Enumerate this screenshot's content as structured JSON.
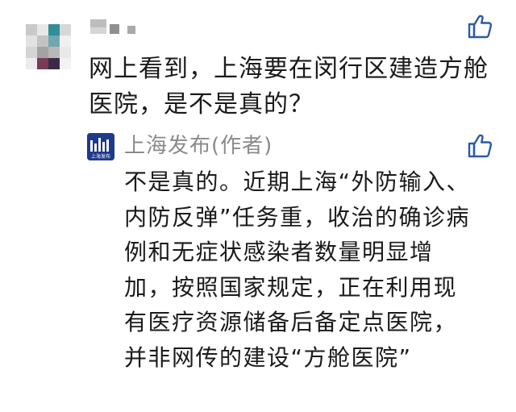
{
  "comment": {
    "user_avatar_icon": "user-avatar-icon",
    "username": "",
    "text": "网上看到，上海要在闵行区建造方舱医院，是不是真的？",
    "like_icon": "thumbs-up-icon"
  },
  "reply": {
    "avatar_icon": "shanghai-fabu-logo-icon",
    "avatar_logo_text": "上海发布",
    "author": "上海发布(作者)",
    "text": "不是真的。近期上海“外防输入、内防反弹”任务重，收治的确诊病例和无症状感染者数量明显增加，按照国家规定，正在利用现有医疗资源储备后备定点医院，并非网传的建设“方舱医院”",
    "like_icon": "thumbs-up-icon"
  },
  "colors": {
    "text": "#1a1a1a",
    "author": "#8a8a8a",
    "like_icon": "#2d5aa8",
    "reply_avatar": "#1f3a8a"
  }
}
